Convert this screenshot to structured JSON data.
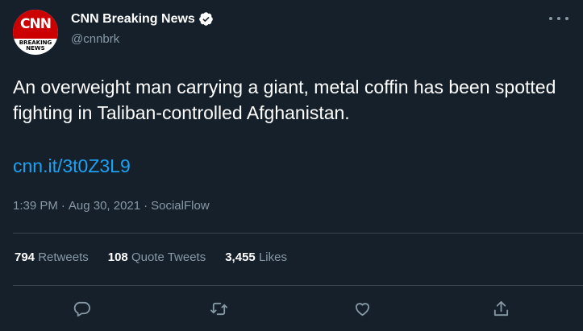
{
  "account": {
    "display_name": "CNN Breaking News",
    "handle": "@cnnbrk",
    "logo_text": "CNN",
    "logo_sub_1": "BREAKING",
    "logo_sub_2": "NEWS"
  },
  "tweet": {
    "text": "An overweight man carrying a giant, metal coffin has been spotted fighting in Taliban-controlled Afghanistan.",
    "link": "cnn.it/3t0Z3L9",
    "time": "1:39 PM",
    "sep1": "·",
    "date": "Aug 30, 2021",
    "sep2": "·",
    "source": "SocialFlow"
  },
  "stats": {
    "retweets_count": "794",
    "retweets_label": "Retweets",
    "quotes_count": "108",
    "quotes_label": "Quote Tweets",
    "likes_count": "3,455",
    "likes_label": "Likes"
  },
  "icons": {
    "verified": "verified-badge-icon",
    "more": "more-dots-icon",
    "reply": "reply-icon",
    "retweet": "retweet-icon",
    "like": "heart-icon",
    "share": "share-icon"
  },
  "colors": {
    "background": "#15202b",
    "text": "#ffffff",
    "secondary": "#8899a6",
    "link": "#1da1f2",
    "divider": "#38444d",
    "cnn_red": "#cc0000"
  }
}
